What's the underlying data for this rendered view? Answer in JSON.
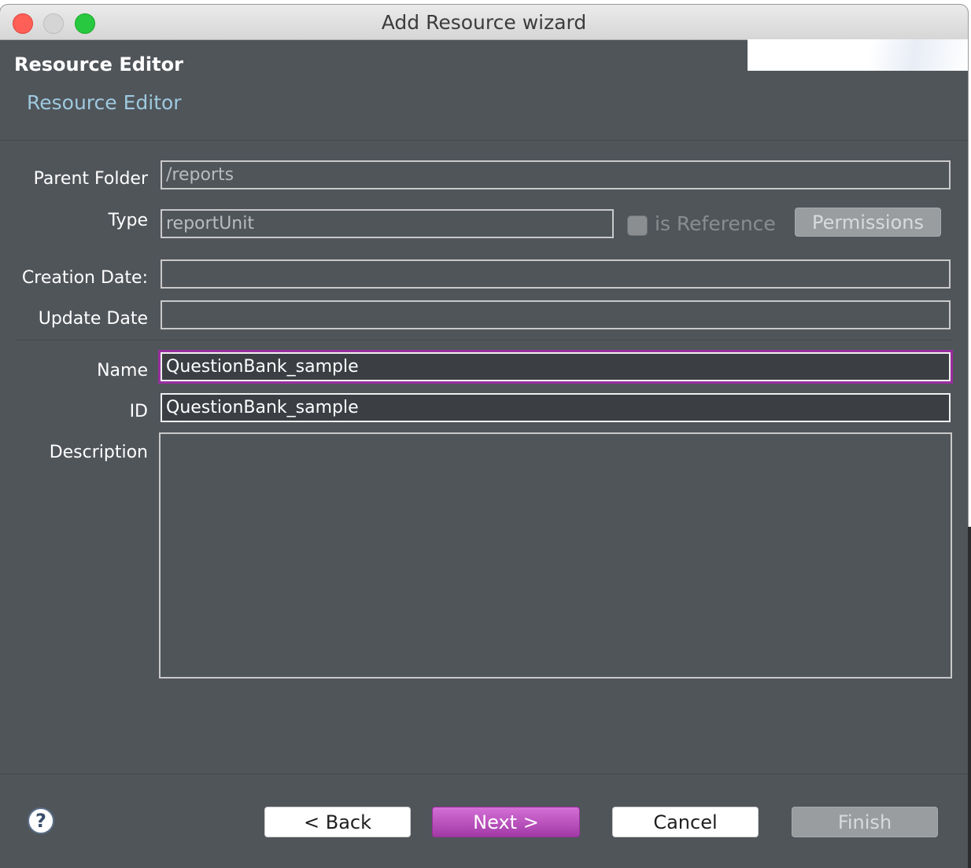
{
  "window": {
    "title": "Add Resource wizard"
  },
  "header": {
    "title": "Resource Editor",
    "subtitle": "Resource Editor"
  },
  "form": {
    "parent_folder": {
      "label": "Parent Folder",
      "value": "/reports"
    },
    "type": {
      "label": "Type",
      "value": "reportUnit"
    },
    "is_reference": {
      "label": "is Reference",
      "checked": false
    },
    "permissions_label": "Permissions",
    "creation_date": {
      "label": "Creation Date:",
      "value": ""
    },
    "update_date": {
      "label": "Update Date",
      "value": ""
    },
    "name": {
      "label": "Name",
      "value": "QuestionBank_sample"
    },
    "id": {
      "label": "ID",
      "value": "QuestionBank_sample"
    },
    "description": {
      "label": "Description",
      "value": ""
    }
  },
  "footer": {
    "help_icon": "question-mark-circle",
    "back_label": "< Back",
    "next_label": "Next >",
    "cancel_label": "Cancel",
    "finish_label": "Finish"
  },
  "colors": {
    "accent": "#b54fb8",
    "link": "#9ec9df",
    "background": "#50555a"
  }
}
